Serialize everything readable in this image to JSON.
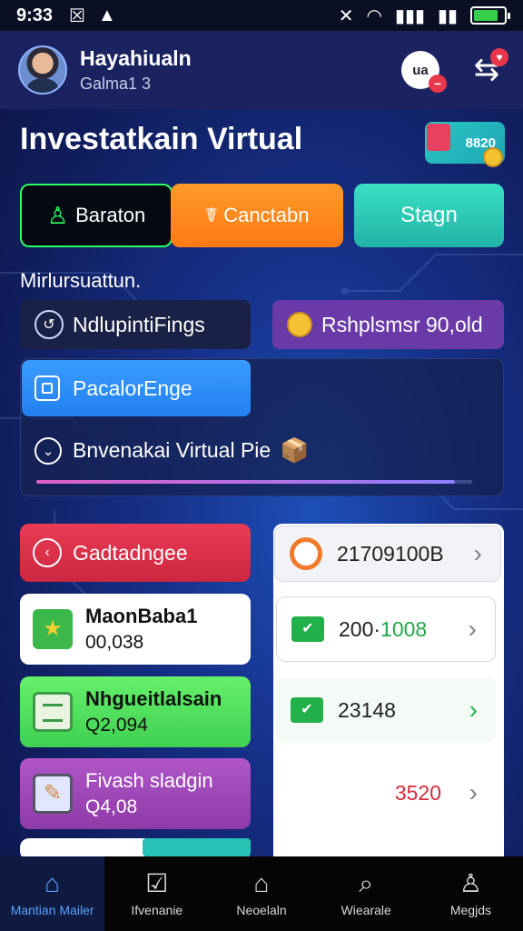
{
  "status_bar": {
    "time": "9:33",
    "icons": [
      "close-icon",
      "alert-icon",
      "mute-icon",
      "wifi-icon",
      "signal-icon",
      "battery-icon"
    ],
    "battery_level": 0.8
  },
  "header": {
    "user_name": "Hayahiualn",
    "user_sub": "Galma1 3",
    "badge_text": "ua"
  },
  "title": "Investatkain Virtual",
  "promo_label": "8820",
  "segments": [
    "Baraton",
    "Canctabn",
    "Stagn"
  ],
  "section_label": "Mirlursuattun.",
  "pills": {
    "a": "NdlupintiFings",
    "b": "Rshplsmsr 90,old",
    "c": "PacalorEnge"
  },
  "virtual_row": {
    "label": "Bnvenakai Virtual Pie",
    "progress": 0.96
  },
  "left_cards": [
    {
      "title": "Gadtadngee"
    },
    {
      "title": "MaonBaba1",
      "value": "00,038"
    },
    {
      "title": "Nhgueitlalsain",
      "value": "Q2,094"
    },
    {
      "title": "Fivash sladgin",
      "value": "Q4,08"
    }
  ],
  "right_items": [
    {
      "value": "21709100B"
    },
    {
      "value_a": "200·",
      "value_b": "1008"
    },
    {
      "value": "23148"
    },
    {
      "value": "3520"
    }
  ],
  "bottom_nav": [
    {
      "label": "Mantian Mailer",
      "icon": "home-icon"
    },
    {
      "label": "Ifvenanie",
      "icon": "clipboard-icon"
    },
    {
      "label": "Neoelaln",
      "icon": "bank-icon"
    },
    {
      "label": "Wiearale",
      "icon": "search-icon"
    },
    {
      "label": "Megjds",
      "icon": "profile-icon"
    }
  ],
  "colors": {
    "background": "#16318a",
    "accent_green": "#2cff62",
    "accent_orange": "#ff8a1e",
    "accent_teal": "#2ccdb6",
    "purple": "#6a3aa8",
    "red": "#e23350"
  }
}
